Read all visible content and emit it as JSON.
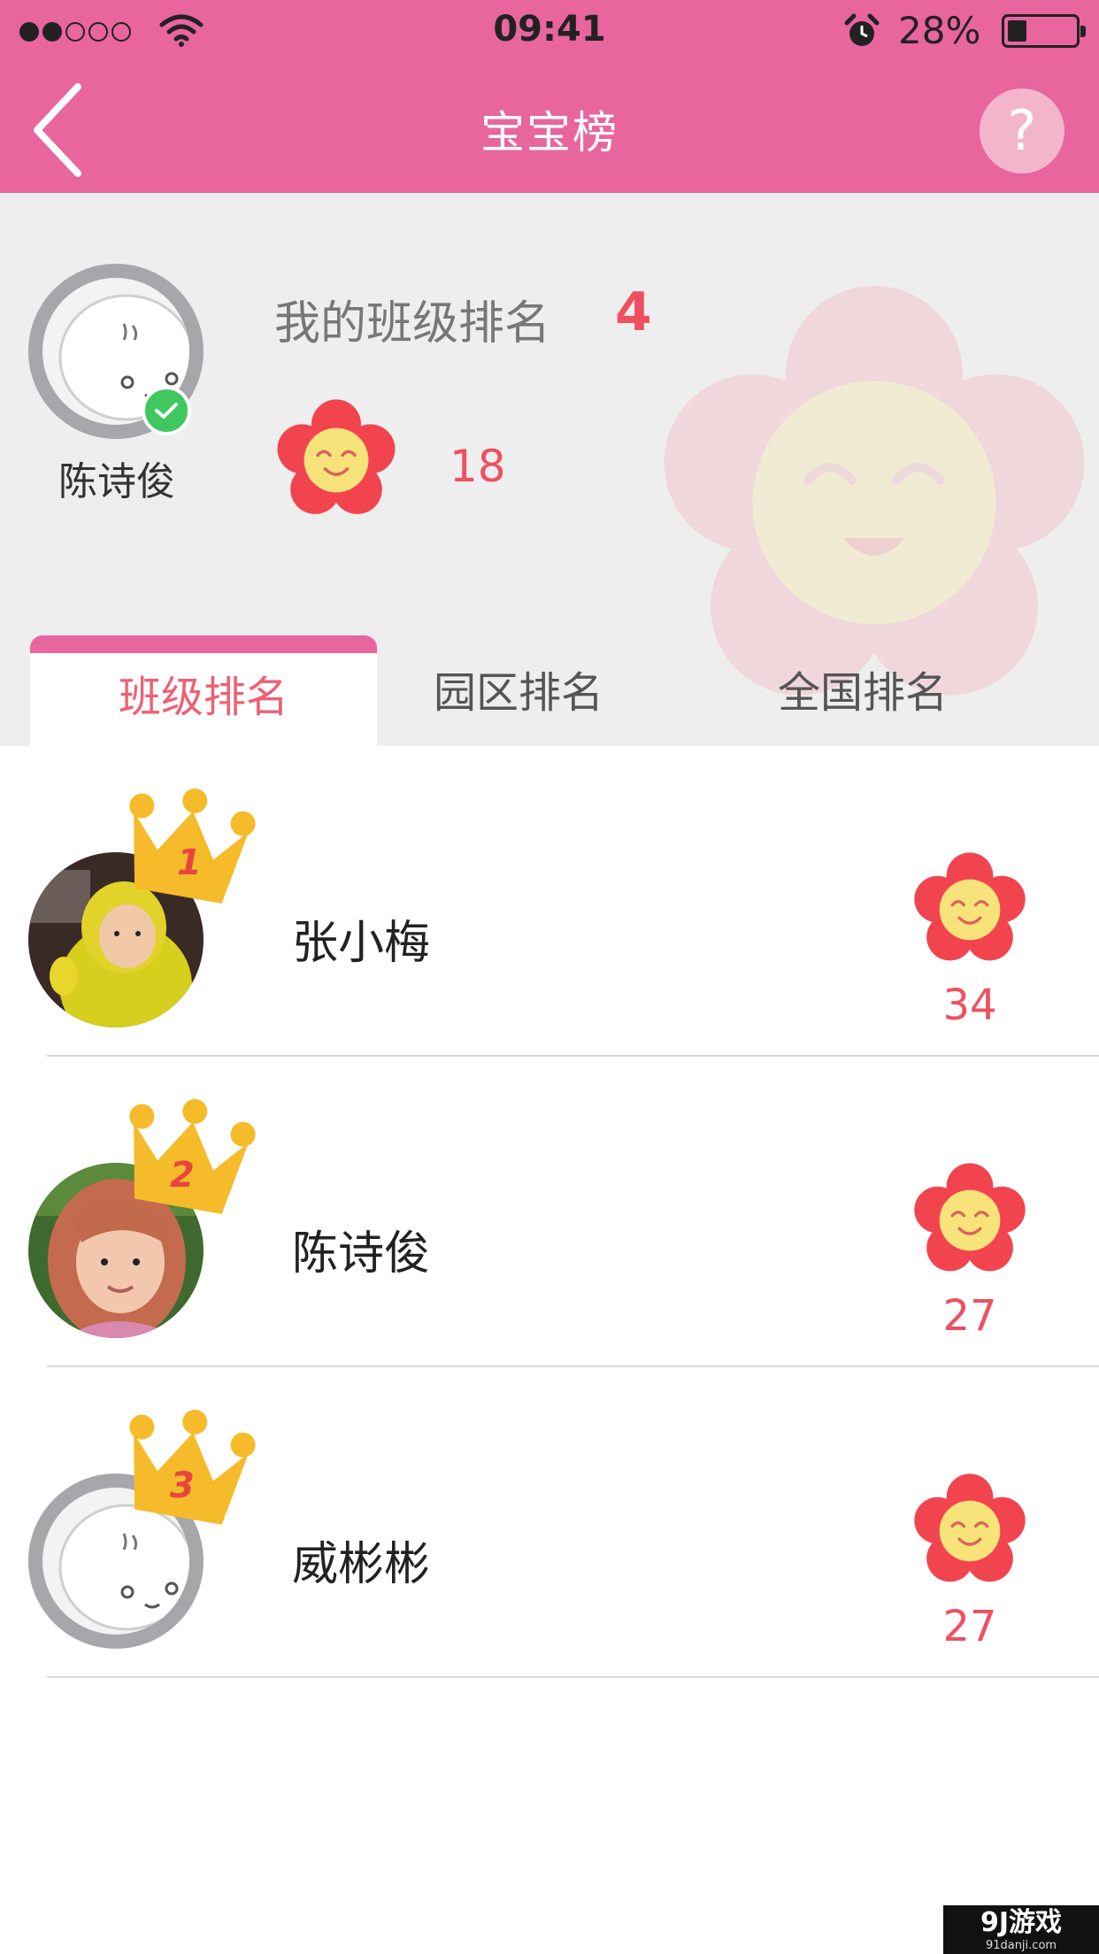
{
  "status_bar": {
    "time": "09:41",
    "battery": "28%",
    "battery_level": 0.28
  },
  "nav": {
    "title": "宝宝榜",
    "help": "?"
  },
  "header": {
    "my_name": "陈诗俊",
    "rank_label": "我的班级排名",
    "rank_value": "4",
    "score": "18"
  },
  "tabs": [
    {
      "label": "班级排名",
      "active": true
    },
    {
      "label": "园区排名",
      "active": false
    },
    {
      "label": "全国排名",
      "active": false
    }
  ],
  "leaderboard": [
    {
      "rank": "1",
      "name": "张小梅",
      "score": "34"
    },
    {
      "rank": "2",
      "name": "陈诗俊",
      "score": "27"
    },
    {
      "rank": "3",
      "name": "威彬彬",
      "score": "27"
    }
  ],
  "watermark": {
    "logo": "9J游戏",
    "site": "91danji.com"
  },
  "colors": {
    "brand_pink": "#e8659e",
    "accent_red": "#ef5060",
    "flower": "#f2444f",
    "crown": "#f6bb2a"
  }
}
